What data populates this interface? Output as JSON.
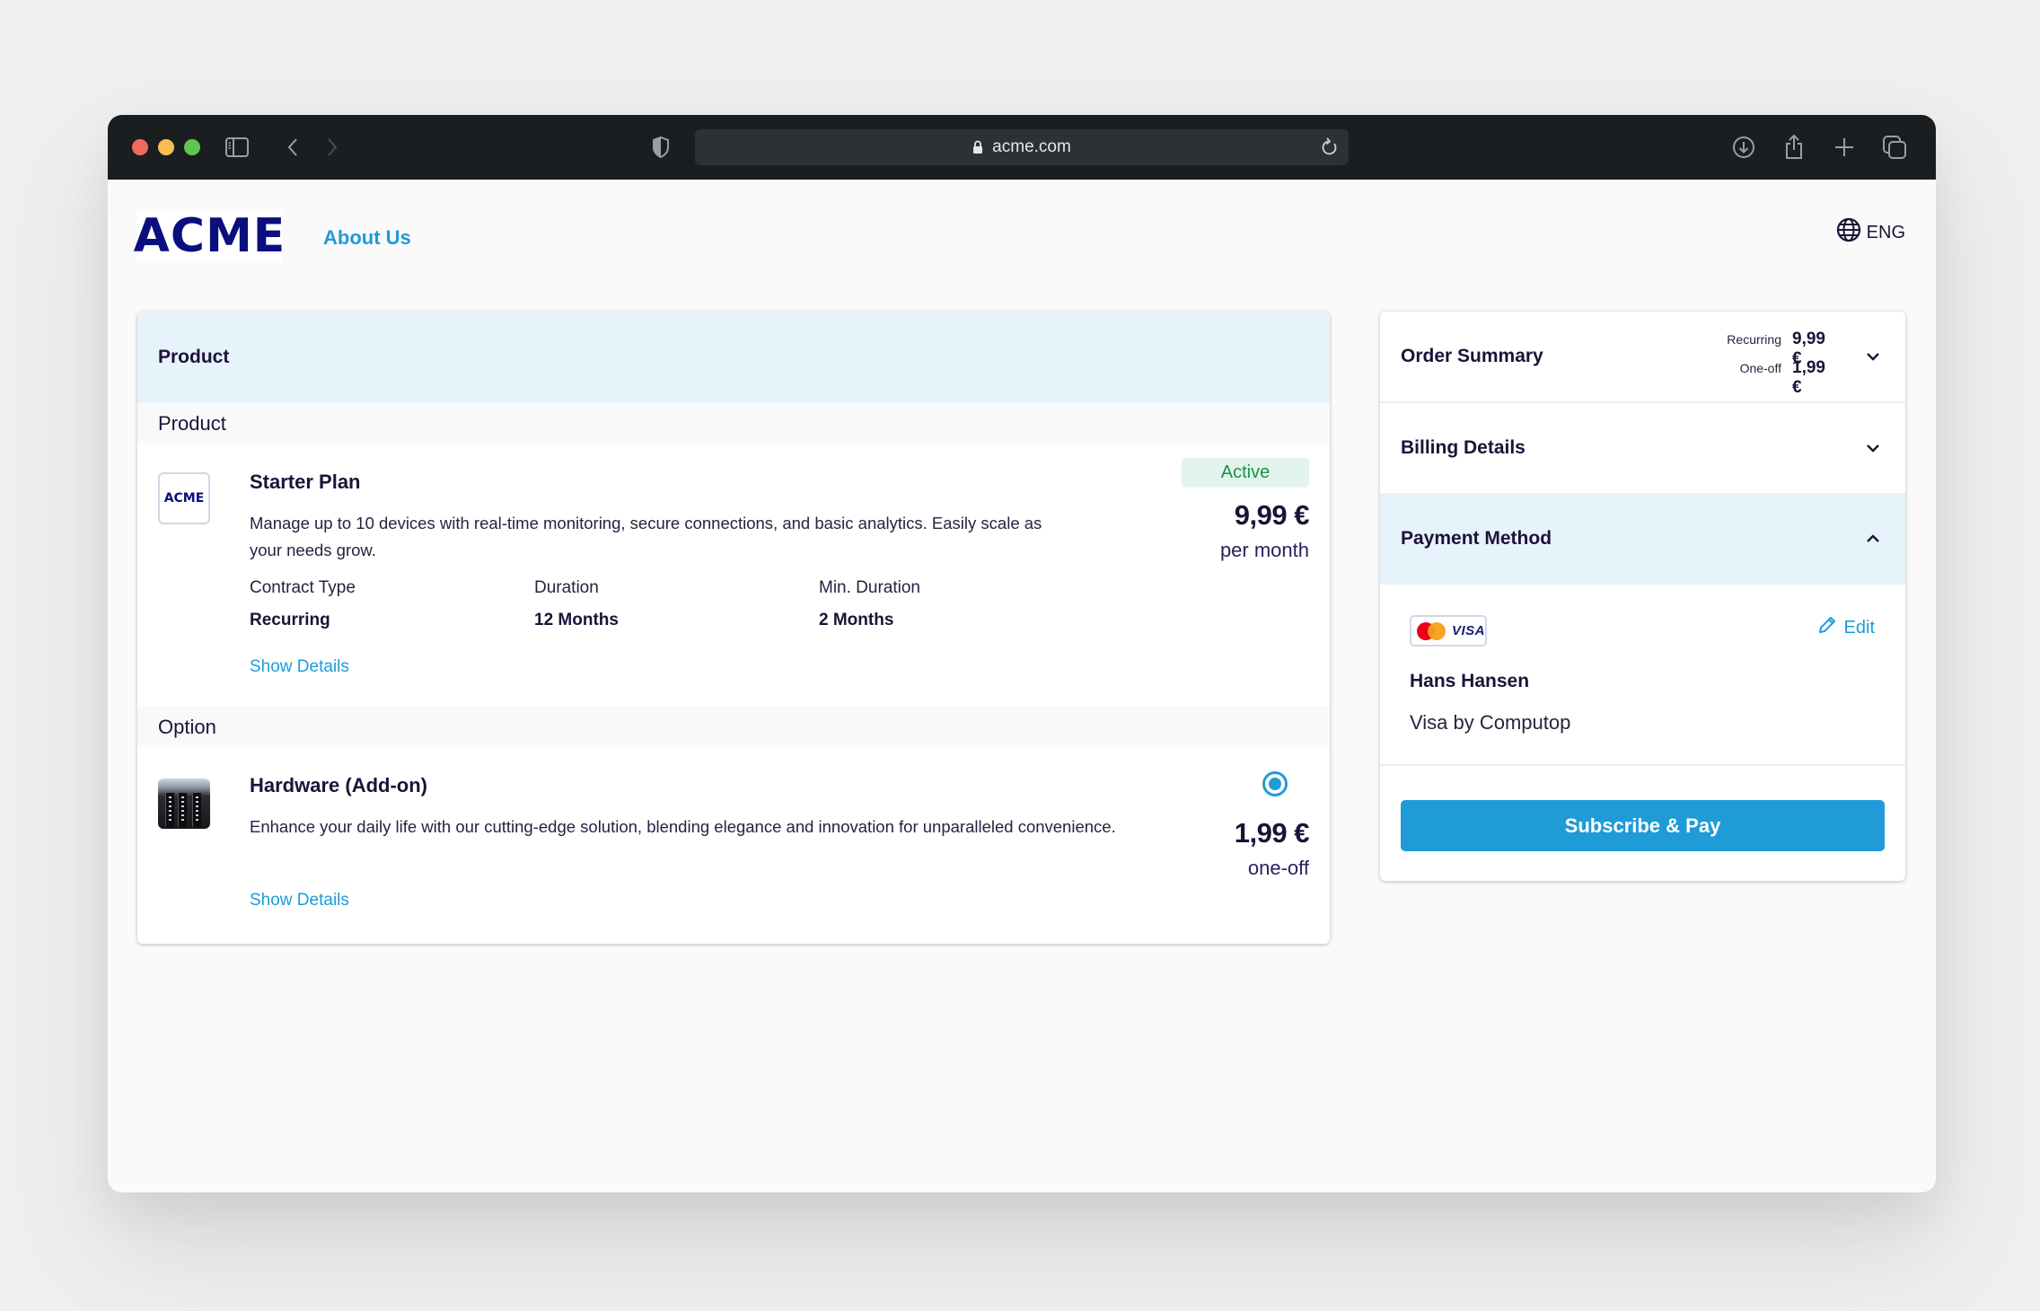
{
  "browser": {
    "url": "acme.com",
    "icons": {
      "sidebar": "sidebar-icon",
      "back": "chevron-left-icon",
      "forward": "chevron-right-icon",
      "privacy": "shield-icon",
      "lock": "lock-icon",
      "reload": "reload-icon",
      "download": "download-icon",
      "share": "share-icon",
      "new_tab": "plus-icon",
      "tabs": "tabs-overview-icon"
    }
  },
  "header": {
    "logo": "ACME",
    "nav": [
      {
        "label": "About Us"
      }
    ],
    "language": "ENG"
  },
  "product_card": {
    "title": "Product",
    "sections": [
      {
        "label": "Product",
        "item": {
          "thumb_text": "ACME",
          "name": "Starter Plan",
          "description": "Manage up to 10 devices with real-time monitoring, secure connections, and basic analytics. Easily scale as your needs grow.",
          "status": "Active",
          "price": "9,99 €",
          "price_unit": "per month",
          "specs": [
            {
              "label": "Contract Type",
              "value": "Recurring"
            },
            {
              "label": "Duration",
              "value": "12 Months"
            },
            {
              "label": "Min. Duration",
              "value": "2 Months"
            }
          ],
          "link": "Show Details"
        }
      },
      {
        "label": "Option",
        "item": {
          "name": "Hardware (Add-on)",
          "description": "Enhance your daily life with our cutting-edge solution, blending elegance and innovation for unparalleled convenience.",
          "selected": true,
          "price": "1,99 €",
          "price_unit": "one-off",
          "link": "Show Details"
        }
      }
    ]
  },
  "sidebar": {
    "order_summary": {
      "title": "Order Summary",
      "expanded": false,
      "totals": [
        {
          "label": "Recurring",
          "value": "9,99 €"
        },
        {
          "label": "One-off",
          "value": "1,99 €"
        }
      ]
    },
    "billing_details": {
      "title": "Billing Details",
      "expanded": false
    },
    "payment_method": {
      "title": "Payment Method",
      "expanded": true,
      "card_brand": "VISA",
      "edit_label": "Edit",
      "holder": "Hans Hansen",
      "issuer": "Visa by Computop"
    },
    "submit_label": "Subscribe & Pay"
  },
  "colors": {
    "accent": "#1f9bd7",
    "text": "#1d1238",
    "logo": "#0b0e7e",
    "header_band": "#e6f3fa",
    "active_badge_bg": "#e3f4ec",
    "active_badge_text": "#16934b"
  }
}
